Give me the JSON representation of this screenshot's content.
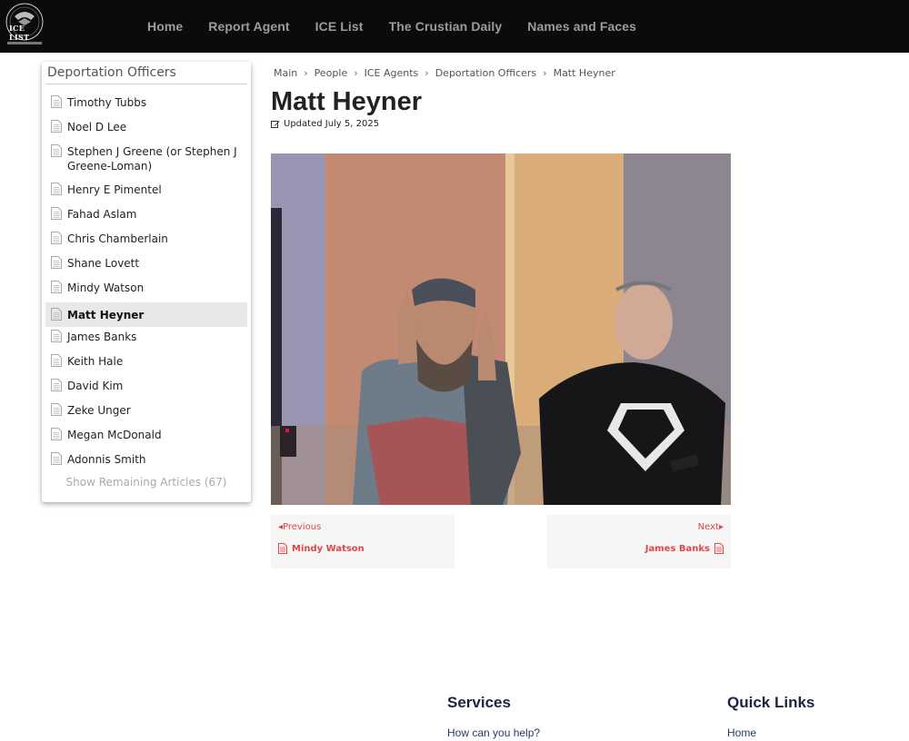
{
  "nav": {
    "logo_text": "ICE LIST",
    "items": [
      "Home",
      "Report Agent",
      "ICE List",
      "The Crustian Daily",
      "Names and Faces"
    ]
  },
  "sidebar": {
    "heading": "Deportation Officers",
    "items": [
      "Timothy Tubbs",
      "Noel D Lee",
      "Stephen J Greene (or Stephen J Greene-Loman)",
      "Henry E Pimentel",
      "Fahad Aslam",
      "Chris Chamberlain",
      "Shane Lovett",
      "Mindy Watson",
      "Matt Heyner",
      "James Banks",
      "Keith Hale",
      "David Kim",
      "Zeke  Unger",
      "Megan  McDonald",
      "Adonnis Smith"
    ],
    "active": "Matt Heyner",
    "more_label": "Show Remaining Articles (67)"
  },
  "breadcrumb": [
    "Main",
    "People",
    "ICE Agents",
    "Deportation Officers",
    "Matt Heyner"
  ],
  "article": {
    "title": "Matt Heyner",
    "updated": "Updated July 5, 2025"
  },
  "pager": {
    "prev_label": "Previous",
    "prev_name": "Mindy Watson",
    "next_label": "Next",
    "next_name": "James Banks"
  },
  "footer": {
    "services_heading": "Services",
    "services_link": "How can you help?",
    "quick_heading": "Quick Links",
    "quick_link": "Home"
  },
  "colors": {
    "accent": "#e04848",
    "topbar": "#0b0b0b",
    "footer_heading": "#1c2340"
  }
}
